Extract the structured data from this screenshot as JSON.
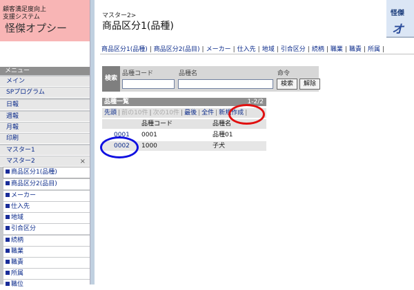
{
  "system": {
    "name": "顧客満足度向上\n支援システム",
    "title": "怪傑オプシー"
  },
  "brand": {
    "line1": "怪傑",
    "line2": "オプ"
  },
  "menu": {
    "header": "メニュー",
    "items": [
      "メイン",
      "SPプログラム",
      "日報",
      "週報",
      "月報",
      "印刷",
      "マスター1",
      "マスター2"
    ],
    "close": "×",
    "subitems": [
      "商品区分1(品種)",
      "商品区分2(品目)",
      "メーカー",
      "仕入先",
      "地域",
      "引合区分",
      "続柄",
      "職業",
      "職責",
      "所属",
      "職位"
    ]
  },
  "breadcrumb": "マスター2>",
  "page_title": "商品区分1(品種)",
  "tabs": [
    "商品区分1(品種)",
    "商品区分2(品目)",
    "メーカー",
    "仕入先",
    "地域",
    "引合区分",
    "続柄",
    "職業",
    "職責",
    "所属"
  ],
  "search": {
    "label": "検索",
    "col_code": "品種コード",
    "col_name": "品種名",
    "col_cmd": "命令",
    "code_value": "",
    "name_value": "",
    "search_button": "検索",
    "clear_button": "解除"
  },
  "list": {
    "title": "品種一覧",
    "count": "1-2/2",
    "pager": {
      "first": "先頭",
      "prev10": "前の10件",
      "next10": "次の10件",
      "last": "最後",
      "all": "全件",
      "new": "新規作成"
    },
    "col_code": "品種コード",
    "col_name": "品種名",
    "rows": [
      {
        "id": "0001",
        "code": "0001",
        "name": "品種01"
      },
      {
        "id": "0002",
        "code": "1000",
        "name": "子犬"
      }
    ]
  },
  "colors": {
    "logo_bg": "#f8b5b5",
    "menu_bg": "#c7c9cc",
    "link": "#0a2a8a",
    "annotation_red": "#e01010",
    "annotation_blue": "#1010e0"
  }
}
